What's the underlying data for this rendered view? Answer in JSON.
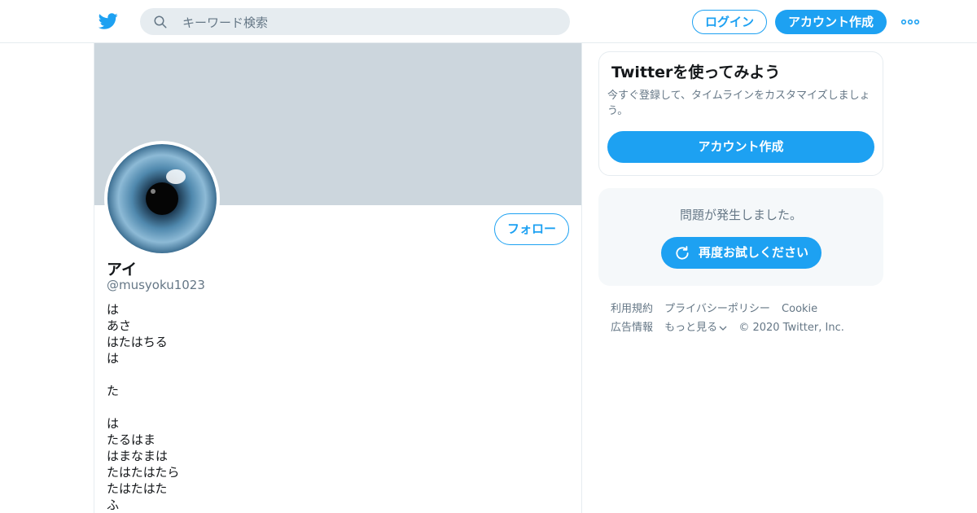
{
  "header": {
    "search_placeholder": "キーワード検索",
    "login_label": "ログイン",
    "signup_label": "アカウント作成"
  },
  "profile": {
    "name": "アイ",
    "handle": "@musyoku1023",
    "follow_label": "フォロー",
    "bio_lines": [
      "は",
      "あさ",
      "はたはちる",
      "は",
      "",
      "た",
      "",
      "は",
      "たるはま",
      "はまなまは",
      "たはたはたら",
      "たはたはた",
      "ふ"
    ]
  },
  "signup_card": {
    "title": "Twitterを使ってみよう",
    "description": "今すぐ登録して、タイムラインをカスタマイズしましょう。",
    "button_label": "アカウント作成"
  },
  "error_card": {
    "message": "問題が発生しました。",
    "retry_label": "再度お試しください"
  },
  "footer": {
    "links": [
      "利用規約",
      "プライバシーポリシー",
      "Cookie",
      "広告情報"
    ],
    "more_label": "もっと見る",
    "copyright": "© 2020 Twitter, Inc."
  },
  "colors": {
    "brand": "#1da1f2",
    "banner": "#ccd6dd",
    "muted_text": "#657786"
  },
  "icons": [
    "twitter-bird-icon",
    "search-icon",
    "more-dots-icon",
    "refresh-icon",
    "chevron-down-icon"
  ]
}
